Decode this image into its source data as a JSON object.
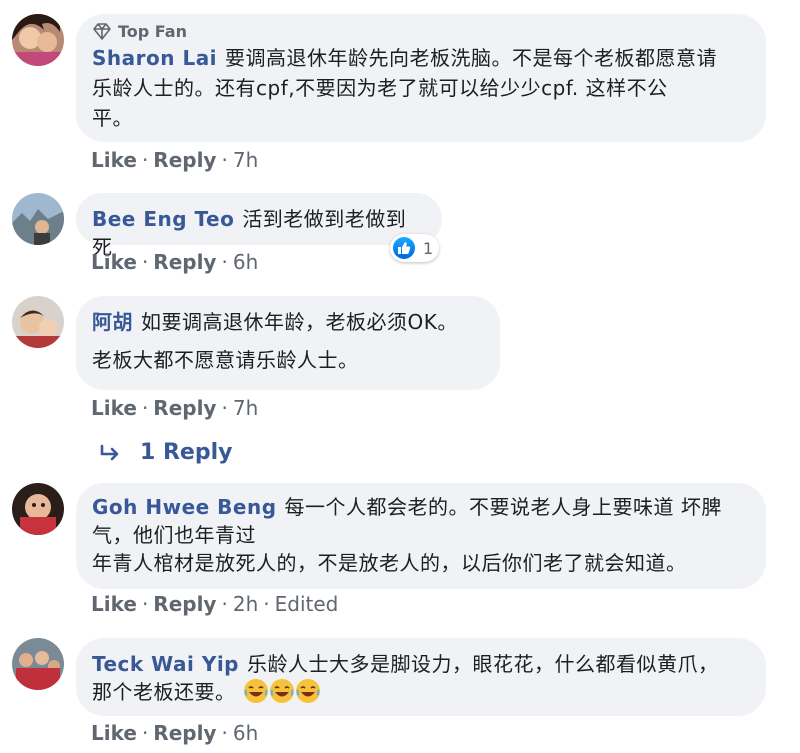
{
  "comments": [
    {
      "badge": "Top Fan",
      "author": "Sharon Lai",
      "text1": "要调高退休年龄先向老板洗脑。不是每个老板都愿意请",
      "text2": "乐龄人士的。还有cpf,不要因为老了就可以给少少cpf. 这样不公",
      "text3": "平。",
      "like": "Like",
      "reply": "Reply",
      "time": "7h"
    },
    {
      "author": "Bee Eng Teo",
      "text1": "活到老做到老做到死",
      "like": "Like",
      "reply": "Reply",
      "time": "6h",
      "reaction_count": "1"
    },
    {
      "author": "阿胡",
      "text1": "如要调高退休年龄，老板必须OK。",
      "text2": "老板大都不愿意请乐龄人士。",
      "like": "Like",
      "reply": "Reply",
      "time": "7h",
      "replies_label": "1 Reply"
    },
    {
      "author": "Goh Hwee Beng",
      "text1": "每一个人都会老的。不要说老人身上要味道 坏脾",
      "text2": "气，他们也年青过",
      "text3": "年青人棺材是放死人的，不是放老人的，以后你们老了就会知道。",
      "like": "Like",
      "reply": "Reply",
      "time": "2h",
      "edited": "Edited"
    },
    {
      "author": "Teck Wai Yip",
      "text1": "乐龄人士大多是脚设力，眼花花，什么都看似黄爪，",
      "text2": "那个老板还要。",
      "like": "Like",
      "reply": "Reply",
      "time": "6h"
    }
  ],
  "colors": {
    "author": "#385898",
    "bubble": "#f0f2f5",
    "meta": "#606770"
  },
  "icons": [
    "diamond-icon",
    "like-reaction-icon",
    "reply-arrow-icon",
    "laughing-emoji-icon"
  ]
}
